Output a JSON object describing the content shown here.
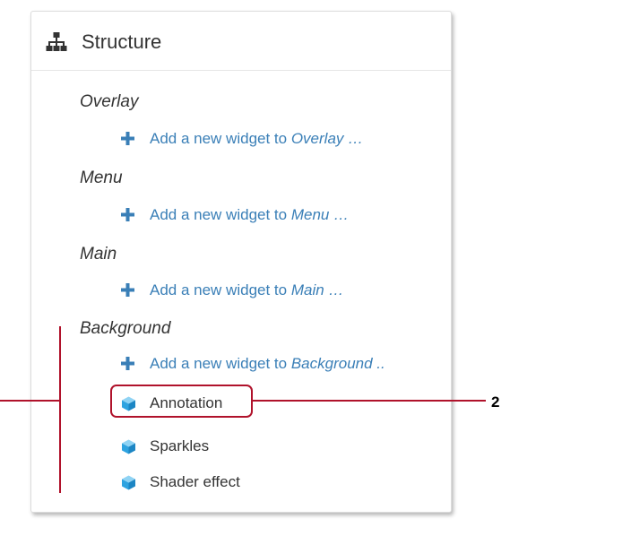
{
  "panel": {
    "title": "Structure",
    "icon": "sitemap-icon"
  },
  "sections": [
    {
      "title": "Overlay",
      "add_prefix": "Add a new widget to ",
      "add_target": "Overlay",
      "add_suffix": " …"
    },
    {
      "title": "Menu",
      "add_prefix": "Add a new widget to ",
      "add_target": "Menu",
      "add_suffix": " …"
    },
    {
      "title": "Main",
      "add_prefix": "Add a new widget to ",
      "add_target": "Main",
      "add_suffix": " …"
    },
    {
      "title": "Background",
      "add_prefix": "Add a new widget to ",
      "add_target": "Background",
      "add_suffix": " ..",
      "widgets": [
        {
          "label": "Annotation",
          "icon": "cube-icon"
        },
        {
          "label": "Sparkles",
          "icon": "cube-icon"
        },
        {
          "label": "Shader effect",
          "icon": "cube-icon"
        }
      ]
    }
  ],
  "callouts": {
    "annotation_number": "2"
  },
  "colors": {
    "link": "#3a7fb7",
    "callout": "#b0122b",
    "cube": "#2ea3e0",
    "text": "#333333"
  }
}
